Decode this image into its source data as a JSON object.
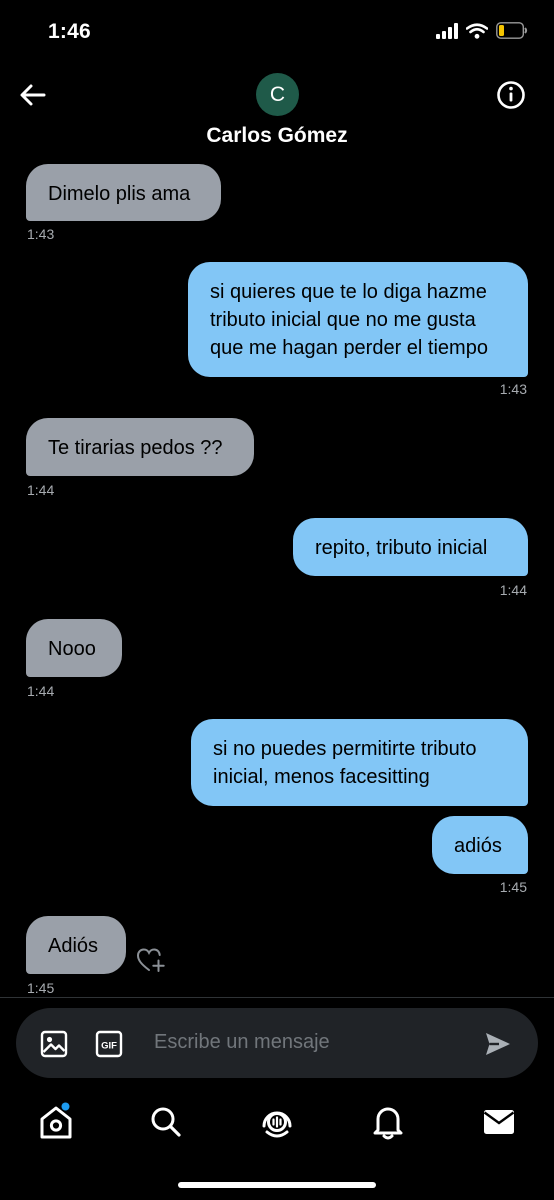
{
  "status_bar": {
    "time": "1:46"
  },
  "header": {
    "avatar_initial": "C",
    "contact_name": "Carlos Gómez"
  },
  "messages": [
    {
      "direction": "incoming",
      "text": "Dimelo plis ama",
      "time": "1:43"
    },
    {
      "direction": "outgoing",
      "text": "si quieres que te lo diga hazme tributo inicial que no me gusta que me hagan perder el tiempo",
      "time": "1:43"
    },
    {
      "direction": "incoming",
      "text": "Te tirarias pedos ??",
      "time": "1:44"
    },
    {
      "direction": "outgoing",
      "text": "repito, tributo inicial",
      "time": "1:44"
    },
    {
      "direction": "incoming",
      "text": "Nooo",
      "time": "1:44"
    },
    {
      "direction": "outgoing",
      "text": "si no puedes permitirte tributo inicial, menos facesitting",
      "time": ""
    },
    {
      "direction": "outgoing",
      "text": "adiós",
      "time": "1:45"
    },
    {
      "direction": "incoming",
      "text": "Adiós",
      "time": "1:45"
    }
  ],
  "composer": {
    "placeholder": "Escribe un mensaje"
  },
  "colors": {
    "incoming_bubble": "#9aa0a9",
    "outgoing_bubble": "#82c6f6",
    "background": "#000000"
  },
  "icons": [
    "back-arrow-icon",
    "info-icon",
    "image-icon",
    "gif-icon",
    "send-icon",
    "heart-plus-icon",
    "home-icon",
    "search-icon",
    "spaces-icon",
    "bell-icon",
    "mail-icon",
    "signal-icon",
    "wifi-icon",
    "battery-icon"
  ]
}
